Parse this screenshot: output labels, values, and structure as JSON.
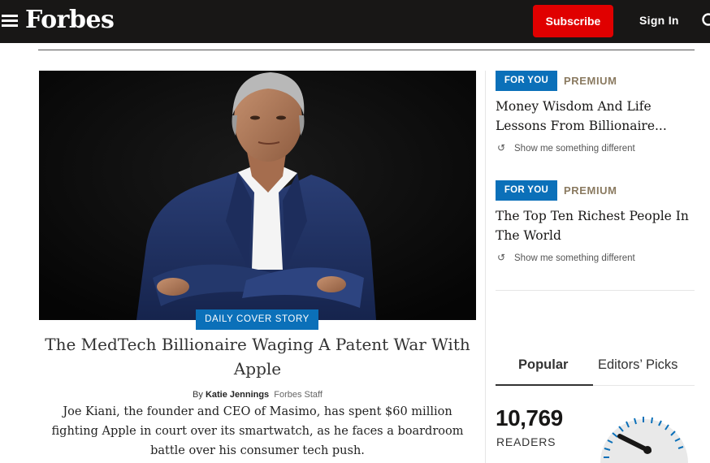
{
  "header": {
    "logo": "Forbes",
    "subscribe_label": "Subscribe",
    "signin_label": "Sign In"
  },
  "hero": {
    "badge": "DAILY COVER STORY",
    "headline": "The MedTech Billionaire Waging A Patent War With Apple",
    "byline_prefix": "By",
    "author": "Katie Jennings",
    "author_role": "Forbes Staff",
    "summary": "Joe Kiani, the founder and CEO of Masimo, has spent $60 million fighting Apple in court over its smartwatch, as he faces a boardroom battle over his consumer tech push."
  },
  "sidebar": {
    "cards": [
      {
        "tag": "FOR YOU",
        "label": "PREMIUM",
        "title": "Money Wisdom And Life Lessons From Billionaire...",
        "show_more": "Show me something different"
      },
      {
        "tag": "FOR YOU",
        "label": "PREMIUM",
        "title": "The Top Ten Richest People In The World",
        "show_more": "Show me something different"
      }
    ],
    "tabs": {
      "popular": "Popular",
      "editors": "Editors’ Picks"
    },
    "readers": {
      "count": "10,769",
      "label": "READERS"
    }
  },
  "colors": {
    "header_bg": "#181716",
    "subscribe": "#e00000",
    "accent_blue": "#0b70b9",
    "premium": "#8a7a60"
  }
}
